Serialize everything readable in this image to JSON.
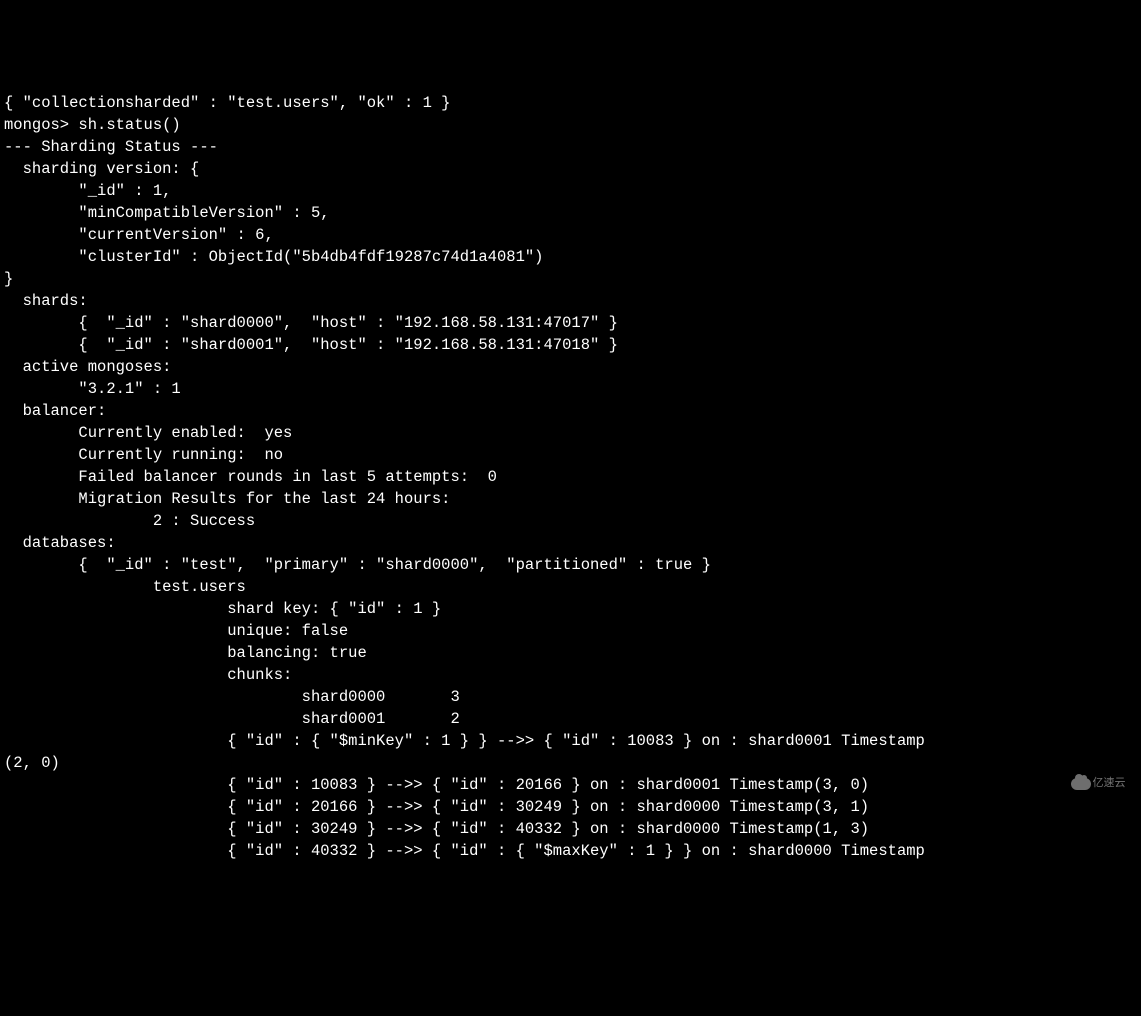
{
  "lines": [
    "{ \"collectionsharded\" : \"test.users\", \"ok\" : 1 }",
    "mongos> sh.status()",
    "--- Sharding Status ---",
    "  sharding version: {",
    "        \"_id\" : 1,",
    "        \"minCompatibleVersion\" : 5,",
    "        \"currentVersion\" : 6,",
    "        \"clusterId\" : ObjectId(\"5b4db4fdf19287c74d1a4081\")",
    "}",
    "  shards:",
    "        {  \"_id\" : \"shard0000\",  \"host\" : \"192.168.58.131:47017\" }",
    "        {  \"_id\" : \"shard0001\",  \"host\" : \"192.168.58.131:47018\" }",
    "  active mongoses:",
    "        \"3.2.1\" : 1",
    "  balancer:",
    "        Currently enabled:  yes",
    "        Currently running:  no",
    "        Failed balancer rounds in last 5 attempts:  0",
    "        Migration Results for the last 24 hours:",
    "                2 : Success",
    "  databases:",
    "        {  \"_id\" : \"test\",  \"primary\" : \"shard0000\",  \"partitioned\" : true }",
    "                test.users",
    "                        shard key: { \"id\" : 1 }",
    "                        unique: false",
    "                        balancing: true",
    "                        chunks:",
    "                                shard0000       3",
    "                                shard0001       2",
    "                        { \"id\" : { \"$minKey\" : 1 } } -->> { \"id\" : 10083 } on : shard0001 Timestamp",
    "(2, 0)",
    "                        { \"id\" : 10083 } -->> { \"id\" : 20166 } on : shard0001 Timestamp(3, 0)",
    "                        { \"id\" : 20166 } -->> { \"id\" : 30249 } on : shard0000 Timestamp(3, 1)",
    "                        { \"id\" : 30249 } -->> { \"id\" : 40332 } on : shard0000 Timestamp(1, 3)",
    "                        { \"id\" : 40332 } -->> { \"id\" : { \"$maxKey\" : 1 } } on : shard0000 Timestamp"
  ],
  "watermark_text": "亿速云"
}
